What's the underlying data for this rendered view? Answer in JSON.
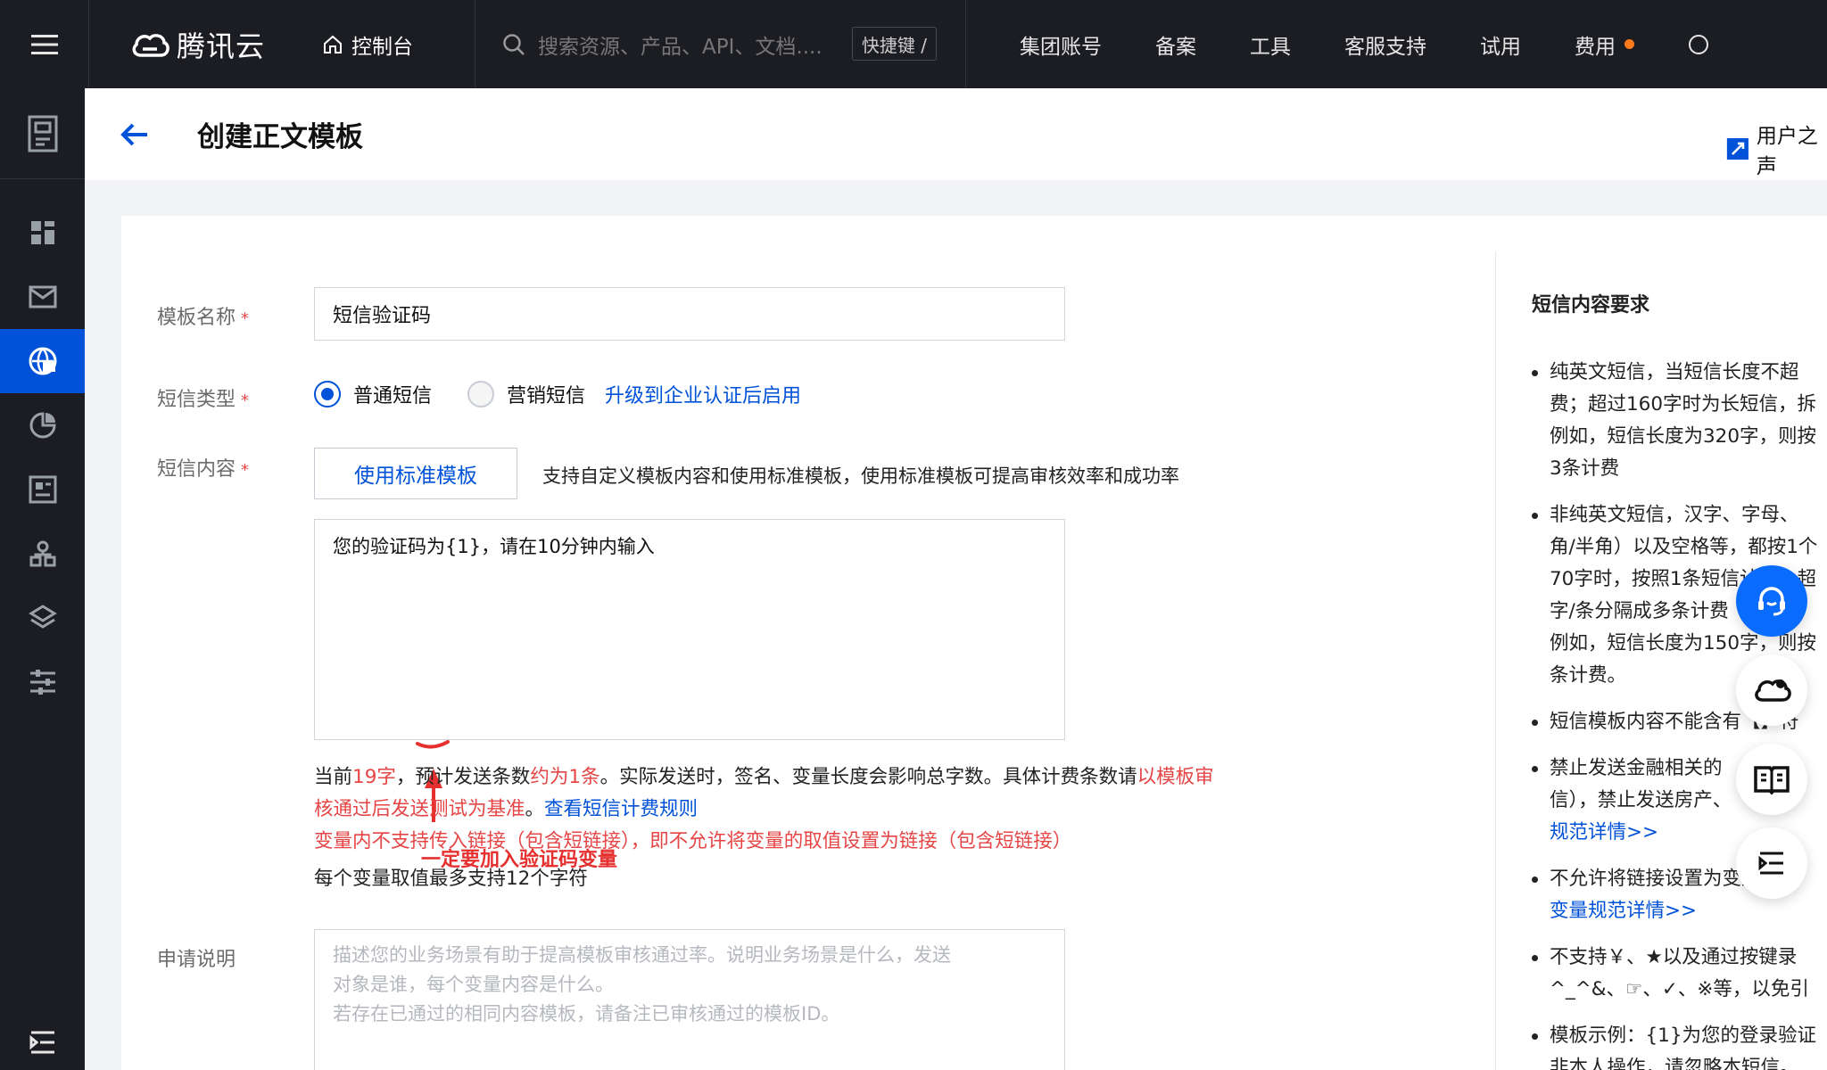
{
  "topbar": {
    "logo_text": "腾讯云",
    "console_label": "控制台",
    "search_placeholder": "搜索资源、产品、API、文档....",
    "shortcut_label": "快捷键 /",
    "nav": [
      "集团账号",
      "备案",
      "工具",
      "客服支持",
      "试用",
      "费用"
    ]
  },
  "page": {
    "title": "创建正文模板",
    "user_voice": "用户之声"
  },
  "form": {
    "name_label": "模板名称",
    "name_value": "短信验证码",
    "type_label": "短信类型",
    "type_options": [
      "普通短信",
      "营销短信"
    ],
    "upgrade_link": "升级到企业认证后启用",
    "content_label": "短信内容",
    "std_template_button": "使用标准模板",
    "std_template_desc": "支持自定义模板内容和使用标准模板，使用标准模板可提高审核效率和成功率",
    "content_value": "您的验证码为{1}，请在10分钟内输入",
    "annotation": "一定要加入验证码变量",
    "count_prefix": "当前",
    "count_chars": "19字",
    "count_mid": "，预计发送条数",
    "count_msgs": "约为1条",
    "count_suffix": "。实际发送时，签名、变量长度会影响总字数。具体计费条数请",
    "count_red": "以模板审核通过后发送测试为基准",
    "count_end": "。",
    "billing_link": "查看短信计费规则",
    "link_warning": "变量内不支持传入链接（包含短链接），即不允许将变量的取值设置为链接（包含短链接）",
    "var_limit": "每个变量取值最多支持12个字符",
    "desc_label": "申请说明",
    "desc_placeholder_1": "描述您的业务场景有助于提高模板审核通过率。说明业务场景是什么，发送",
    "desc_placeholder_2": "对象是谁，每个变量内容是什么。",
    "desc_placeholder_3": "若存在已通过的相同内容模板，请备注已审核通过的模板ID。"
  },
  "right_panel": {
    "title": "短信内容要求",
    "items": [
      [
        "纯英文短信，当短信长度不超",
        "费；超过160字时为长短信，拆",
        "例如，短信长度为320字，则按",
        "3条计费"
      ],
      [
        "非纯英文短信，汉字、字母、",
        "角/半角）以及空格等，都按1个",
        "70字时，按照1条短信计费；超",
        "字/条分隔成多条计费",
        "例如，短信长度为150字，则按",
        "条计费。"
      ],
      [
        "短信模板内容不能含有【】符"
      ],
      [
        "禁止发送金融相关的",
        "信），禁止发送房产、",
        "规范详情>>"
      ],
      [
        "不允许将链接设置为变量（包",
        "变量规范详情>>"
      ],
      [
        "不支持￥、★以及通过按键录",
        "^_^&、☞、✓、※等，以免引"
      ],
      [
        "模板示例：{1}为您的登录验证",
        "非本人操作，请忽略本短信。"
      ]
    ]
  },
  "colors": {
    "brand_blue": "#0052d9",
    "topbar_bg": "#1c1d22",
    "warning_red": "#e54545",
    "annotation_red": "#e63030"
  }
}
